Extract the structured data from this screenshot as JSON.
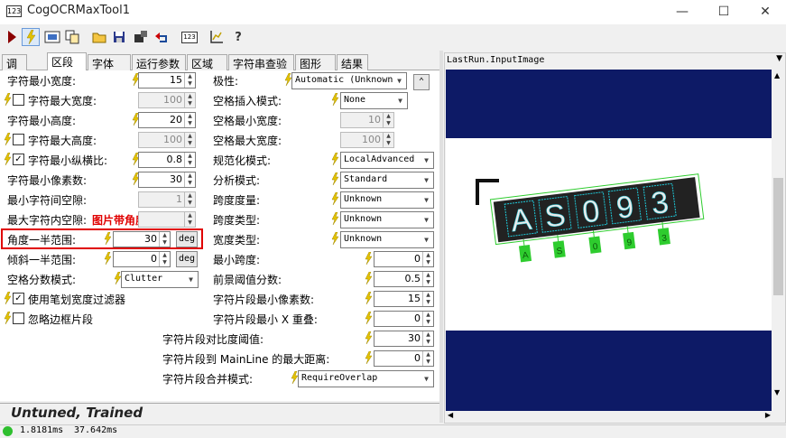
{
  "window": {
    "title": "CogOCRMaxTool1",
    "icon_text": "123",
    "minimize": "—",
    "maximize": "☐",
    "close": "✕"
  },
  "toolbar": {
    "icons": [
      "run-icon",
      "lightning-icon",
      "image-icon",
      "copy-icon",
      "open-icon",
      "save-icon",
      "camera-icon",
      "undo-icon",
      "digits-icon",
      "graph-icon",
      "help-icon"
    ]
  },
  "tabs": [
    "调整",
    "区段",
    "字体",
    "运行参数",
    "区域",
    "字符串查验",
    "图形",
    "结果"
  ],
  "active_tab": "区段",
  "left_fields": [
    {
      "label": "字符最小宽度:",
      "value": "15",
      "enabled": true
    },
    {
      "label": "字符最大宽度:",
      "value": "100",
      "enabled": false,
      "checked": false
    },
    {
      "label": "字符最小高度:",
      "value": "20",
      "enabled": true
    },
    {
      "label": "字符最大高度:",
      "value": "100",
      "enabled": false,
      "checked": false
    },
    {
      "label": "字符最小纵横比:",
      "value": "0.8",
      "enabled": true,
      "checked": true
    },
    {
      "label": "字符最小像素数:",
      "value": "30",
      "enabled": true
    },
    {
      "label": "最小字符间空隙:",
      "value": "1",
      "enabled": false
    },
    {
      "label": "最大字符内空隙:",
      "value": "",
      "enabled": false
    },
    {
      "label": "角度一半范围:",
      "value": "30",
      "enabled": true,
      "unit": "deg"
    },
    {
      "label": "倾斜一半范围:",
      "value": "0",
      "enabled": true,
      "unit": "deg"
    },
    {
      "label": "空格分数模式:",
      "value": "Clutter",
      "enabled": true
    }
  ],
  "annotation": "图片带角度识别",
  "checkbox_rows": [
    {
      "label": "使用笔划宽度过滤器",
      "checked": true
    },
    {
      "label": "忽略边框片段",
      "checked": false
    }
  ],
  "right_fields": [
    {
      "label": "极性:",
      "value": "Automatic (Unknown",
      "enabled": true
    },
    {
      "label": "空格插入模式:",
      "value": "None",
      "enabled": true
    },
    {
      "label": "空格最小宽度:",
      "value": "10",
      "enabled": false
    },
    {
      "label": "空格最大宽度:",
      "value": "100",
      "enabled": false
    },
    {
      "label": "规范化模式:",
      "value": "LocalAdvanced",
      "enabled": true
    },
    {
      "label": "分析模式:",
      "value": "Standard",
      "enabled": true
    },
    {
      "label": "跨度度量:",
      "value": "Unknown",
      "enabled": true
    },
    {
      "label": "跨度类型:",
      "value": "Unknown",
      "enabled": true
    },
    {
      "label": "宽度类型:",
      "value": "Unknown",
      "enabled": true
    },
    {
      "label": "最小跨度:",
      "value": "0",
      "enabled": true
    },
    {
      "label": "前景阈值分数:",
      "value": "0.5",
      "enabled": true
    },
    {
      "label": "字符片段最小像素数:",
      "value": "15",
      "enabled": true
    },
    {
      "label": "字符片段最小 X 重叠:",
      "value": "0",
      "enabled": true
    }
  ],
  "bottom_fields": [
    {
      "label": "字符片段对比度阈值:",
      "value": "30"
    },
    {
      "label": "字符片段到 MainLine 的最大距离:",
      "value": "0"
    },
    {
      "label": "字符片段合并模式:",
      "value": "RequireOverlap"
    }
  ],
  "status": {
    "label": "Untuned, Trained",
    "time1": "1.8181ms",
    "time2": "37.642ms"
  },
  "image_panel": {
    "title": "LastRun.InputImage",
    "ocr_text": [
      "A",
      "S",
      "0",
      "9",
      "3"
    ],
    "band_color": "#0d1a66"
  }
}
